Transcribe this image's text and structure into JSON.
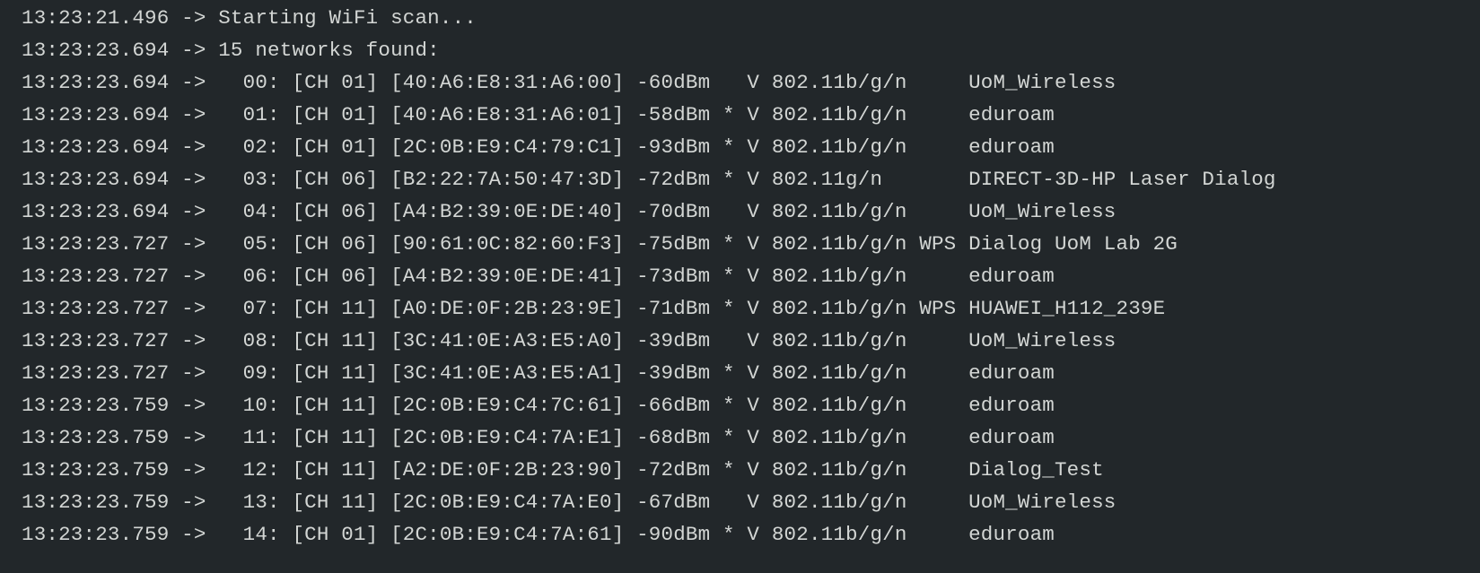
{
  "serial_monitor": {
    "lines": [
      "13:23:21.496 -> Starting WiFi scan...",
      "13:23:23.694 -> 15 networks found:",
      "13:23:23.694 ->   00: [CH 01] [40:A6:E8:31:A6:00] -60dBm   V 802.11b/g/n     UoM_Wireless",
      "13:23:23.694 ->   01: [CH 01] [40:A6:E8:31:A6:01] -58dBm * V 802.11b/g/n     eduroam",
      "13:23:23.694 ->   02: [CH 01] [2C:0B:E9:C4:79:C1] -93dBm * V 802.11b/g/n     eduroam",
      "13:23:23.694 ->   03: [CH 06] [B2:22:7A:50:47:3D] -72dBm * V 802.11g/n       DIRECT-3D-HP Laser Dialog",
      "13:23:23.694 ->   04: [CH 06] [A4:B2:39:0E:DE:40] -70dBm   V 802.11b/g/n     UoM_Wireless",
      "13:23:23.727 ->   05: [CH 06] [90:61:0C:82:60:F3] -75dBm * V 802.11b/g/n WPS Dialog UoM Lab 2G",
      "13:23:23.727 ->   06: [CH 06] [A4:B2:39:0E:DE:41] -73dBm * V 802.11b/g/n     eduroam",
      "13:23:23.727 ->   07: [CH 11] [A0:DE:0F:2B:23:9E] -71dBm * V 802.11b/g/n WPS HUAWEI_H112_239E",
      "13:23:23.727 ->   08: [CH 11] [3C:41:0E:A3:E5:A0] -39dBm   V 802.11b/g/n     UoM_Wireless",
      "13:23:23.727 ->   09: [CH 11] [3C:41:0E:A3:E5:A1] -39dBm * V 802.11b/g/n     eduroam",
      "13:23:23.759 ->   10: [CH 11] [2C:0B:E9:C4:7C:61] -66dBm * V 802.11b/g/n     eduroam",
      "13:23:23.759 ->   11: [CH 11] [2C:0B:E9:C4:7A:E1] -68dBm * V 802.11b/g/n     eduroam",
      "13:23:23.759 ->   12: [CH 11] [A2:DE:0F:2B:23:90] -72dBm * V 802.11b/g/n     Dialog_Test",
      "13:23:23.759 ->   13: [CH 11] [2C:0B:E9:C4:7A:E0] -67dBm   V 802.11b/g/n     UoM_Wireless",
      "13:23:23.759 ->   14: [CH 01] [2C:0B:E9:C4:7A:61] -90dBm * V 802.11b/g/n     eduroam"
    ],
    "colors": {
      "background": "#22272a",
      "text": "#d3d6d4"
    }
  }
}
